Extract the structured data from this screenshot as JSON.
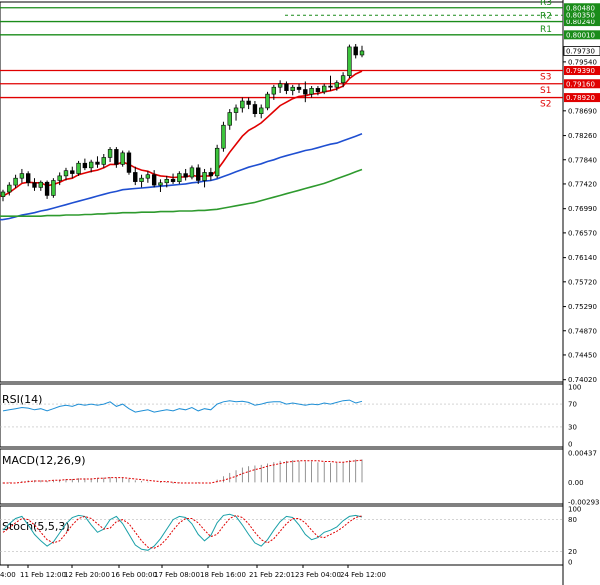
{
  "chart_data": {
    "type": "candlestick",
    "title": "",
    "price_axis": {
      "ticks": [
        "0.79540",
        "0.78690",
        "0.78260",
        "0.77840",
        "0.77420",
        "0.76990",
        "0.76570",
        "0.76140",
        "0.75720",
        "0.75290",
        "0.74870",
        "0.74450",
        "0.74020"
      ],
      "tick_values": [
        0.7954,
        0.7869,
        0.7826,
        0.7784,
        0.7742,
        0.7699,
        0.7657,
        0.7614,
        0.7572,
        0.7529,
        0.7487,
        0.7445,
        0.7402
      ],
      "range": [
        0.7398,
        0.8058
      ]
    },
    "time_axis": {
      "labels": [
        "4:00",
        "11 Feb 12:00",
        "12 Feb 20:00",
        "16 Feb 00:00",
        "17 Feb 08:00",
        "18 Feb 16:00",
        "21 Feb 22:01",
        "23 Feb 04:00",
        "24 Feb 12:00"
      ]
    },
    "current_price": {
      "label": "0.79730",
      "value": 0.7973,
      "color": "#000000"
    },
    "levels": [
      {
        "name": "R3",
        "label": "0.80480",
        "value": 0.8048,
        "color": "#1a8c1a"
      },
      {
        "name": "R2",
        "label": "0.80240",
        "value": 0.8024,
        "color": "#1a8c1a"
      },
      {
        "name": "R1",
        "label": "0.80010",
        "value": 0.8001,
        "color": "#1a8c1a"
      },
      {
        "name": "S1",
        "label": "0.79160",
        "value": 0.7916,
        "color": "#e00000"
      },
      {
        "name": "S2",
        "label": "0.78920",
        "value": 0.7892,
        "color": "#e00000"
      },
      {
        "name": "S3",
        "label": "",
        "value": 0.7939,
        "color": "#e00000"
      }
    ],
    "extra_price_labels": [
      {
        "label": "0.80350",
        "value": 0.8035,
        "color": "#1a8c1a"
      },
      {
        "label": "0.79390",
        "value": 0.7939,
        "color": "#e00000"
      }
    ],
    "candles": [
      [
        0.772,
        0.7732,
        0.7712,
        0.7728
      ],
      [
        0.7728,
        0.7745,
        0.7722,
        0.774
      ],
      [
        0.774,
        0.7758,
        0.7735,
        0.7752
      ],
      [
        0.7752,
        0.7768,
        0.7744,
        0.776
      ],
      [
        0.776,
        0.7764,
        0.7738,
        0.7744
      ],
      [
        0.7744,
        0.7752,
        0.773,
        0.7736
      ],
      [
        0.7736,
        0.7748,
        0.773,
        0.7745
      ],
      [
        0.7745,
        0.7748,
        0.7716,
        0.7722
      ],
      [
        0.7722,
        0.7752,
        0.7718,
        0.7748
      ],
      [
        0.7748,
        0.7762,
        0.774,
        0.7756
      ],
      [
        0.7756,
        0.777,
        0.7748,
        0.7765
      ],
      [
        0.7765,
        0.7772,
        0.7752,
        0.776
      ],
      [
        0.776,
        0.7782,
        0.7756,
        0.7778
      ],
      [
        0.7778,
        0.7786,
        0.7766,
        0.777
      ],
      [
        0.777,
        0.7784,
        0.7762,
        0.778
      ],
      [
        0.778,
        0.779,
        0.777,
        0.7776
      ],
      [
        0.7776,
        0.7794,
        0.777,
        0.7788
      ],
      [
        0.7788,
        0.7806,
        0.778,
        0.7802
      ],
      [
        0.7802,
        0.7806,
        0.777,
        0.7776
      ],
      [
        0.7776,
        0.78,
        0.7772,
        0.7796
      ],
      [
        0.7796,
        0.78,
        0.7758,
        0.7762
      ],
      [
        0.7762,
        0.7772,
        0.774,
        0.7746
      ],
      [
        0.7746,
        0.7758,
        0.7736,
        0.7752
      ],
      [
        0.7752,
        0.7764,
        0.7744,
        0.7758
      ],
      [
        0.7758,
        0.7766,
        0.7736,
        0.774
      ],
      [
        0.774,
        0.775,
        0.7728,
        0.7744
      ],
      [
        0.7744,
        0.7756,
        0.7736,
        0.775
      ],
      [
        0.775,
        0.776,
        0.7742,
        0.7746
      ],
      [
        0.7746,
        0.7764,
        0.7742,
        0.776
      ],
      [
        0.776,
        0.7768,
        0.7748,
        0.7754
      ],
      [
        0.7754,
        0.7774,
        0.775,
        0.777
      ],
      [
        0.777,
        0.7776,
        0.7742,
        0.7748
      ],
      [
        0.7748,
        0.7768,
        0.7736,
        0.7762
      ],
      [
        0.7762,
        0.777,
        0.7748,
        0.7756
      ],
      [
        0.7756,
        0.781,
        0.7752,
        0.7804
      ],
      [
        0.7804,
        0.785,
        0.7798,
        0.7844
      ],
      [
        0.7844,
        0.7872,
        0.7836,
        0.7866
      ],
      [
        0.7866,
        0.788,
        0.7852,
        0.7874
      ],
      [
        0.7874,
        0.7892,
        0.7866,
        0.7886
      ],
      [
        0.7886,
        0.7892,
        0.7872,
        0.788
      ],
      [
        0.788,
        0.7886,
        0.7858,
        0.7864
      ],
      [
        0.7864,
        0.788,
        0.7856,
        0.7874
      ],
      [
        0.7874,
        0.7902,
        0.787,
        0.7898
      ],
      [
        0.7898,
        0.7914,
        0.7888,
        0.791
      ],
      [
        0.791,
        0.7922,
        0.79,
        0.7916
      ],
      [
        0.7916,
        0.792,
        0.7898,
        0.7904
      ],
      [
        0.7904,
        0.7914,
        0.7896,
        0.791
      ],
      [
        0.791,
        0.7916,
        0.79,
        0.7906
      ],
      [
        0.7906,
        0.792,
        0.7884,
        0.7898
      ],
      [
        0.7898,
        0.7912,
        0.7892,
        0.7908
      ],
      [
        0.7908,
        0.7912,
        0.7896,
        0.7902
      ],
      [
        0.7902,
        0.7916,
        0.7898,
        0.7912
      ],
      [
        0.7912,
        0.793,
        0.7904,
        0.791
      ],
      [
        0.791,
        0.7922,
        0.7904,
        0.7918
      ],
      [
        0.7918,
        0.7936,
        0.791,
        0.793
      ],
      [
        0.793,
        0.7984,
        0.7926,
        0.798
      ],
      [
        0.798,
        0.7985,
        0.796,
        0.7966
      ],
      [
        0.7966,
        0.7982,
        0.7962,
        0.7973
      ]
    ],
    "moving_averages": [
      {
        "color": "#e00000",
        "values": [
          0.7721,
          0.7727,
          0.7735,
          0.7743,
          0.7745,
          0.7744,
          0.7744,
          0.7739,
          0.7741,
          0.7745,
          0.775,
          0.7752,
          0.7758,
          0.7761,
          0.7764,
          0.7766,
          0.777,
          0.7776,
          0.7776,
          0.778,
          0.7776,
          0.777,
          0.7766,
          0.7764,
          0.7759,
          0.7756,
          0.7755,
          0.7753,
          0.7754,
          0.7754,
          0.7757,
          0.7755,
          0.7756,
          0.7756,
          0.7766,
          0.7781,
          0.7797,
          0.7811,
          0.7825,
          0.7835,
          0.7841,
          0.7848,
          0.7858,
          0.7868,
          0.7878,
          0.7884,
          0.789,
          0.7894,
          0.7895,
          0.7898,
          0.7899,
          0.7902,
          0.7904,
          0.7907,
          0.7912,
          0.7925,
          0.7933,
          0.7938
        ]
      },
      {
        "color": "#1f4fd1",
        "values": [
          0.768,
          0.7682,
          0.7685,
          0.7688,
          0.769,
          0.7692,
          0.7695,
          0.7697,
          0.77,
          0.7703,
          0.7706,
          0.7709,
          0.7712,
          0.7715,
          0.7718,
          0.7721,
          0.7724,
          0.7727,
          0.7729,
          0.7732,
          0.7733,
          0.7734,
          0.7735,
          0.7736,
          0.7737,
          0.7738,
          0.7739,
          0.774,
          0.7741,
          0.7742,
          0.7744,
          0.7745,
          0.7747,
          0.7748,
          0.7751,
          0.7755,
          0.7759,
          0.7763,
          0.7767,
          0.7771,
          0.7774,
          0.7777,
          0.7781,
          0.7784,
          0.7788,
          0.7791,
          0.7794,
          0.7797,
          0.78,
          0.7802,
          0.7805,
          0.7808,
          0.7811,
          0.7813,
          0.7817,
          0.7821,
          0.7825,
          0.7829
        ]
      },
      {
        "color": "#2e9a2e",
        "values": [
          0.7686,
          0.7686,
          0.7686,
          0.7686,
          0.7686,
          0.7686,
          0.7686,
          0.7687,
          0.7687,
          0.7687,
          0.7688,
          0.7688,
          0.7688,
          0.7689,
          0.7689,
          0.769,
          0.769,
          0.7691,
          0.7691,
          0.7692,
          0.7692,
          0.7692,
          0.7693,
          0.7693,
          0.7693,
          0.7694,
          0.7694,
          0.7694,
          0.7695,
          0.7695,
          0.7695,
          0.7696,
          0.7696,
          0.7697,
          0.7698,
          0.77,
          0.7702,
          0.7704,
          0.7706,
          0.7708,
          0.771,
          0.7713,
          0.7716,
          0.7719,
          0.7722,
          0.7725,
          0.7728,
          0.7731,
          0.7734,
          0.7737,
          0.774,
          0.7743,
          0.7747,
          0.7751,
          0.7755,
          0.7759,
          0.7763,
          0.7767
        ]
      }
    ],
    "indicators": {
      "rsi": {
        "title": "RSI(14)",
        "ticks": [
          "100",
          "70",
          "30",
          "0"
        ],
        "tick_values": [
          100,
          70,
          30,
          0
        ],
        "values": [
          58,
          60,
          62,
          64,
          63,
          60,
          62,
          58,
          62,
          66,
          68,
          66,
          70,
          68,
          70,
          68,
          70,
          74,
          66,
          70,
          62,
          56,
          58,
          60,
          56,
          58,
          60,
          58,
          62,
          60,
          64,
          58,
          62,
          60,
          70,
          74,
          76,
          74,
          75,
          73,
          68,
          70,
          73,
          74,
          74,
          70,
          72,
          70,
          68,
          70,
          69,
          72,
          70,
          73,
          76,
          77,
          72,
          75
        ]
      },
      "macd": {
        "title": "MACD(12,26,9)",
        "ticks": [
          "0.00437",
          "0.00",
          "-0.002935"
        ],
        "tick_values": [
          0.00437,
          0.0,
          -0.002935
        ],
        "range": [
          -0.002935,
          0.00437
        ],
        "hist": [
          -0.0002,
          -0.0001,
          0.0,
          0.0002,
          0.0003,
          0.0003,
          0.0003,
          0.0002,
          0.0003,
          0.0004,
          0.0005,
          0.0005,
          0.0006,
          0.0006,
          0.0006,
          0.0006,
          0.0007,
          0.0008,
          0.0007,
          0.0007,
          0.0005,
          0.0003,
          0.0002,
          0.0001,
          0.0,
          -0.0001,
          -0.0001,
          -0.0002,
          -0.0001,
          -0.0001,
          0.0,
          -0.0001,
          0.0,
          0.0,
          0.0004,
          0.0009,
          0.0014,
          0.0018,
          0.0022,
          0.0024,
          0.0025,
          0.0026,
          0.0028,
          0.003,
          0.0032,
          0.0032,
          0.0033,
          0.0032,
          0.0031,
          0.0031,
          0.003,
          0.003,
          0.0029,
          0.0029,
          0.003,
          0.0033,
          0.0034,
          0.0034
        ],
        "signal": [
          -0.0001,
          -0.0001,
          -0.0001,
          0.0,
          0.0001,
          0.0002,
          0.0002,
          0.0002,
          0.0003,
          0.0003,
          0.0004,
          0.0004,
          0.0005,
          0.0005,
          0.0005,
          0.0006,
          0.0006,
          0.0007,
          0.0007,
          0.0007,
          0.0006,
          0.0005,
          0.0004,
          0.0003,
          0.0002,
          0.0001,
          0.0001,
          0.0,
          -0.0001,
          -0.0001,
          -0.0001,
          -0.0001,
          -0.0001,
          -0.0001,
          0.0001,
          0.0003,
          0.0006,
          0.0009,
          0.0013,
          0.0016,
          0.0019,
          0.0021,
          0.0024,
          0.0026,
          0.0028,
          0.003,
          0.0031,
          0.0032,
          0.0032,
          0.0032,
          0.0032,
          0.0031,
          0.0031,
          0.003,
          0.003,
          0.0031,
          0.0032,
          0.0033
        ]
      },
      "stoch": {
        "title": "Stoch(5,5,3)",
        "ticks": [
          "100",
          "80",
          "20",
          "0"
        ],
        "tick_values": [
          100,
          80,
          20,
          0
        ],
        "main": [
          60,
          72,
          82,
          86,
          70,
          52,
          40,
          30,
          38,
          55,
          72,
          84,
          88,
          86,
          70,
          56,
          62,
          80,
          86,
          72,
          52,
          32,
          24,
          22,
          30,
          44,
          62,
          80,
          86,
          84,
          72,
          52,
          40,
          50,
          74,
          88,
          90,
          86,
          70,
          52,
          36,
          30,
          42,
          60,
          76,
          86,
          84,
          70,
          52,
          42,
          46,
          56,
          60,
          66,
          78,
          86,
          88,
          85
        ],
        "signal": [
          56,
          64,
          74,
          82,
          80,
          70,
          56,
          42,
          36,
          40,
          54,
          70,
          82,
          86,
          82,
          72,
          62,
          64,
          76,
          80,
          72,
          56,
          40,
          28,
          26,
          32,
          44,
          60,
          74,
          82,
          82,
          74,
          60,
          48,
          52,
          68,
          82,
          88,
          84,
          72,
          56,
          42,
          36,
          44,
          58,
          72,
          82,
          82,
          74,
          60,
          48,
          46,
          52,
          58,
          66,
          76,
          84,
          87
        ]
      }
    }
  }
}
